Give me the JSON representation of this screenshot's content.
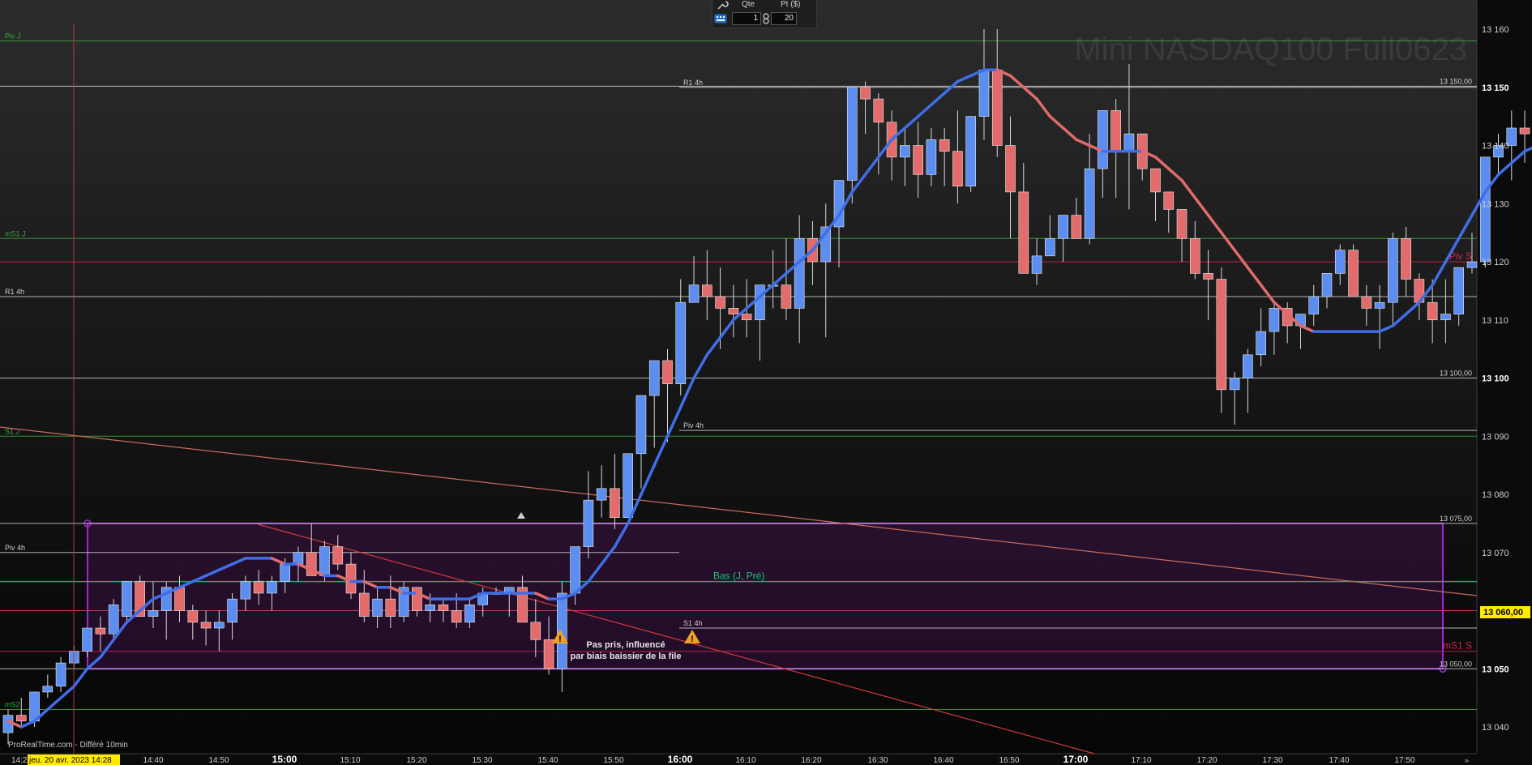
{
  "order_bar": {
    "qty_label": "Qte",
    "qty_value": "1",
    "pts_label": "Pt ($)",
    "pts_value": "20",
    "keypad_icon": "keypad-icon",
    "tool_icon": "wrench-icon",
    "lock_icon": "link-icon"
  },
  "chart_data": {
    "type": "candlestick",
    "title": "Mini NASDAQ100 Full0623",
    "footer": "ProRealTime.com - Différé 10min",
    "crosshair_time_label": "jeu. 20 avr. 2023 14:28",
    "price_cursor_label": "13 060,00",
    "x_tick_labels": [
      "14:2",
      "14:40",
      "14:50",
      "15:00",
      "15:10",
      "15:20",
      "15:30",
      "15:40",
      "15:50",
      "16:00",
      "16:10",
      "16:20",
      "16:30",
      "16:40",
      "16:50",
      "17:00",
      "17:10",
      "17:20",
      "17:30",
      "17:40",
      "17:50"
    ],
    "y_tick_labels": [
      "13 160",
      "13 150",
      "13 140",
      "13 130",
      "13 120",
      "13 110",
      "13 100",
      "13 090",
      "13 080",
      "13 070",
      "13 060,00",
      "13 050",
      "13 040"
    ],
    "ylim": [
      13036,
      13162
    ],
    "colors": {
      "up": "#5b8ef0",
      "down": "#e36b6b",
      "ma_up": "#3f6ee8",
      "ma_down": "#e06b6b",
      "zone": "#9a2ad0",
      "price_cursor": "#ffeb00"
    },
    "candles": [
      [
        13039,
        13043,
        13037,
        13042
      ],
      [
        13042,
        13045,
        13040,
        13041
      ],
      [
        13041,
        13046,
        13040,
        13046
      ],
      [
        13046,
        13049,
        13045,
        13047
      ],
      [
        13047,
        13052,
        13046,
        13051
      ],
      [
        13051,
        13054,
        13050,
        13053
      ],
      [
        13053,
        13057,
        13052,
        13057
      ],
      [
        13057,
        13059,
        13053,
        13056
      ],
      [
        13056,
        13062,
        13055,
        13061
      ],
      [
        13059,
        13065,
        13058,
        13065
      ],
      [
        13065,
        13066,
        13059,
        13059
      ],
      [
        13059,
        13065,
        13057,
        13060
      ],
      [
        13060,
        13065,
        13055,
        13064
      ],
      [
        13064,
        13066,
        13058,
        13060
      ],
      [
        13060,
        13061,
        13055,
        13058
      ],
      [
        13058,
        13060,
        13054,
        13057
      ],
      [
        13057,
        13060,
        13053,
        13058
      ],
      [
        13058,
        13063,
        13055,
        13062
      ],
      [
        13062,
        13066,
        13060,
        13065
      ],
      [
        13065,
        13067,
        13061,
        13063
      ],
      [
        13063,
        13066,
        13060,
        13065
      ],
      [
        13065,
        13069,
        13063,
        13068
      ],
      [
        13068,
        13071,
        13065,
        13070
      ],
      [
        13070,
        13075,
        13067,
        13066
      ],
      [
        13066,
        13072,
        13065,
        13071
      ],
      [
        13071,
        13073,
        13067,
        13068
      ],
      [
        13068,
        13070,
        13062,
        13063
      ],
      [
        13063,
        13067,
        13058,
        13059
      ],
      [
        13059,
        13064,
        13057,
        13062
      ],
      [
        13062,
        13066,
        13057,
        13059
      ],
      [
        13059,
        13065,
        13058,
        13064
      ],
      [
        13064,
        13064,
        13059,
        13060
      ],
      [
        13060,
        13063,
        13058,
        13061
      ],
      [
        13061,
        13062,
        13058,
        13060
      ],
      [
        13060,
        13063,
        13057,
        13058
      ],
      [
        13058,
        13062,
        13057,
        13061
      ],
      [
        13061,
        13064,
        13059,
        13063
      ],
      [
        13063,
        13064,
        13063,
        13063
      ],
      [
        13063,
        13064,
        13059,
        13064
      ],
      [
        13064,
        13066,
        13059,
        13058
      ],
      [
        13058,
        13062,
        13052,
        13055
      ],
      [
        13055,
        13059,
        13049,
        13050
      ],
      [
        13050,
        13065,
        13046,
        13063
      ],
      [
        13063,
        13069,
        13061,
        13071
      ],
      [
        13071,
        13084,
        13069,
        13079
      ],
      [
        13079,
        13085,
        13076,
        13081
      ],
      [
        13081,
        13087,
        13074,
        13076
      ],
      [
        13076,
        13084,
        13077,
        13087
      ],
      [
        13087,
        13090,
        13081,
        13097
      ],
      [
        13097,
        13100,
        13088,
        13103
      ],
      [
        13103,
        13105,
        13089,
        13099
      ],
      [
        13099,
        13117,
        13097,
        13113
      ],
      [
        13113,
        13121,
        13113,
        13116
      ],
      [
        13116,
        13122,
        13110,
        13114
      ],
      [
        13114,
        13119,
        13105,
        13112
      ],
      [
        13112,
        13116,
        13107,
        13111
      ],
      [
        13111,
        13117,
        13107,
        13110
      ],
      [
        13110,
        13112,
        13103,
        13116
      ],
      [
        13116,
        13122,
        13112,
        13116
      ],
      [
        13116,
        13124,
        13110,
        13112
      ],
      [
        13112,
        13128,
        13106,
        13124
      ],
      [
        13124,
        13127,
        13116,
        13120
      ],
      [
        13120,
        13130,
        13107,
        13126
      ],
      [
        13126,
        13132,
        13119,
        13134
      ],
      [
        13134,
        13150,
        13130,
        13150
      ],
      [
        13150,
        13151,
        13142,
        13148
      ],
      [
        13148,
        13149,
        13135,
        13144
      ],
      [
        13144,
        13146,
        13134,
        13138
      ],
      [
        13138,
        13143,
        13133,
        13140
      ],
      [
        13140,
        13144,
        13131,
        13135
      ],
      [
        13135,
        13143,
        13133,
        13141
      ],
      [
        13141,
        13143,
        13133,
        13139
      ],
      [
        13139,
        13146,
        13130,
        13133
      ],
      [
        13133,
        13145,
        13132,
        13145
      ],
      [
        13145,
        13160,
        13141,
        13153
      ],
      [
        13153,
        13160,
        13138,
        13140
      ],
      [
        13140,
        13145,
        13124,
        13132
      ],
      [
        13132,
        13137,
        13121,
        13118
      ],
      [
        13118,
        13124,
        13116,
        13121
      ],
      [
        13121,
        13128,
        13124,
        13124
      ],
      [
        13124,
        13128,
        13120,
        13128
      ],
      [
        13128,
        13131,
        13124,
        13124
      ],
      [
        13124,
        13142,
        13123,
        13136
      ],
      [
        13136,
        13140,
        13131,
        13146
      ],
      [
        13146,
        13148,
        13131,
        13139
      ],
      [
        13139,
        13154,
        13129,
        13142
      ],
      [
        13142,
        13140,
        13134,
        13136
      ],
      [
        13136,
        13133,
        13127,
        13132
      ],
      [
        13132,
        13131,
        13125,
        13129
      ],
      [
        13129,
        13127,
        13120,
        13124
      ],
      [
        13124,
        13127,
        13117,
        13118
      ],
      [
        13118,
        13122,
        13110,
        13117
      ],
      [
        13117,
        13119,
        13094,
        13098
      ],
      [
        13098,
        13101,
        13092,
        13100
      ],
      [
        13100,
        13105,
        13094,
        13104
      ],
      [
        13104,
        13112,
        13102,
        13108
      ],
      [
        13108,
        13113,
        13104,
        13112
      ],
      [
        13112,
        13113,
        13106,
        13109
      ],
      [
        13109,
        13111,
        13105,
        13111
      ],
      [
        13111,
        13116,
        13109,
        13114
      ],
      [
        13114,
        13118,
        13112,
        13118
      ],
      [
        13118,
        13123,
        13116,
        13122
      ],
      [
        13122,
        13123,
        13114,
        13114
      ],
      [
        13114,
        13116,
        13109,
        13112
      ],
      [
        13112,
        13116,
        13105,
        13113
      ],
      [
        13113,
        13125,
        13109,
        13124
      ],
      [
        13124,
        13126,
        13114,
        13117
      ],
      [
        13117,
        13118,
        13110,
        13113
      ],
      [
        13113,
        13117,
        13106,
        13110
      ],
      [
        13110,
        13117,
        13106,
        13111
      ],
      [
        13111,
        13119,
        13109,
        13119
      ],
      [
        13119,
        13125,
        13118,
        13120
      ],
      [
        13120,
        13138,
        13119,
        13138
      ],
      [
        13138,
        13142,
        13135,
        13140
      ],
      [
        13140,
        13146,
        13134,
        13143
      ],
      [
        13143,
        13146,
        13137,
        13142
      ],
      [
        13142,
        13139,
        13133,
        13138
      ],
      [
        13138,
        13142,
        13132,
        13142
      ],
      [
        13142,
        13141,
        13136,
        13140
      ],
      [
        13140,
        13144,
        13138,
        13141
      ],
      [
        13141,
        13146,
        13136,
        13147
      ],
      [
        13147,
        13149,
        13135,
        13137
      ],
      [
        13137,
        13136,
        13130,
        13132
      ]
    ],
    "moving_average": [
      13041,
      13040,
      13041,
      13043,
      13045,
      13047,
      13050,
      13052,
      13055,
      13058,
      13060,
      13062,
      13063,
      13064,
      13065,
      13066,
      13067,
      13068,
      13069,
      13069,
      13069,
      13068,
      13068,
      13067,
      13066,
      13066,
      13065,
      13065,
      13064,
      13064,
      13063,
      13063,
      13062,
      13062,
      13062,
      13062,
      13063,
      13063,
      13063,
      13063,
      13063,
      13062,
      13062,
      13063,
      13065,
      13068,
      13071,
      13075,
      13080,
      13085,
      13090,
      13095,
      13100,
      13104,
      13107,
      13110,
      13112,
      13114,
      13116,
      13118,
      13120,
      13122,
      13125,
      13128,
      13132,
      13135,
      13138,
      13141,
      13143,
      13145,
      13147,
      13149,
      13151,
      13152,
      13153,
      13153,
      13152,
      13150,
      13148,
      13145,
      13143,
      13141,
      13140,
      13139,
      13139,
      13139,
      13139,
      13138,
      13136,
      13134,
      13131,
      13128,
      13125,
      13122,
      13119,
      13116,
      13113,
      13111,
      13109,
      13108,
      13108,
      13108,
      13108,
      13108,
      13108,
      13109,
      13111,
      13113,
      13116,
      13120,
      13124,
      13128,
      13132,
      13135,
      13137,
      13139,
      13140
    ],
    "horizontal_levels": [
      {
        "label": "Piv J",
        "price": 13158,
        "color": "#3fa83f"
      },
      {
        "label": "R1 4h",
        "price": 13150,
        "color": "#cfcfcf"
      },
      {
        "label": "13 150,00",
        "price": 13150.2,
        "color": "#cfcfcf"
      },
      {
        "label": "mS1 J",
        "price": 13124,
        "color": "#3fa83f"
      },
      {
        "label": "Piv S",
        "price": 13120,
        "color": "#d4244e"
      },
      {
        "label": "R1 4h",
        "price": 13114,
        "color": "#cfcfcf"
      },
      {
        "label": "13 100,00",
        "price": 13100,
        "color": "#cfcfcf"
      },
      {
        "label": "Piv 4h",
        "price": 13091,
        "color": "#cfcfcf"
      },
      {
        "label": "S1 J",
        "price": 13090,
        "color": "#3fa83f"
      },
      {
        "label": "13 075,00",
        "price": 13075,
        "color": "#cfcfcf"
      },
      {
        "label": "Piv 4h",
        "price": 13070,
        "color": "#cfcfcf"
      },
      {
        "label": "Bas (J, Pré)",
        "price": 13065,
        "color": "#21c27a"
      },
      {
        "label": "",
        "price": 13060,
        "color": "#d2475c"
      },
      {
        "label": "S1 4h",
        "price": 13057,
        "color": "#cfcfcf"
      },
      {
        "label": "mS1 S",
        "price": 13053,
        "color": "#d4244e"
      },
      {
        "label": "13 050,00",
        "price": 13050,
        "color": "#cfcfcf"
      },
      {
        "label": "mS2",
        "price": 13043,
        "color": "#3fa83f"
      }
    ],
    "zone": {
      "from_price": 13050,
      "to_price": 13075
    },
    "annotation": {
      "line1": "Pas pris, influencé",
      "line2": "par biais baissier de la file"
    }
  }
}
